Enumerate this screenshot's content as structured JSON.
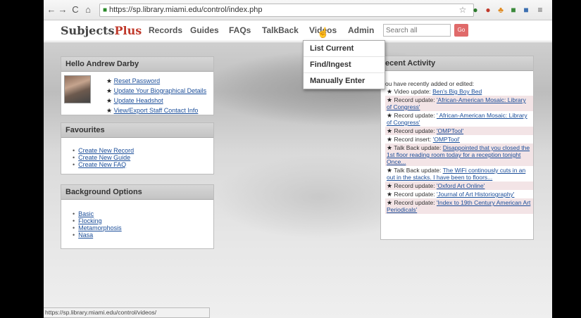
{
  "browser": {
    "url": "https://sp.library.miami.edu/control/index.php",
    "status_url": "https://sp.library.miami.edu/control/videos/"
  },
  "site": {
    "logo_main": "Subjects",
    "logo_accent": "Plus",
    "nav": [
      "Records",
      "Guides",
      "FAQs",
      "TalkBack",
      "Videos",
      "Admin"
    ],
    "search_placeholder": "Search all",
    "search_button": "Go"
  },
  "dropdown": {
    "items": [
      "List Current",
      "Find/Ingest",
      "Manually Enter"
    ]
  },
  "hello": {
    "title": "Hello Andrew Darby",
    "links": [
      "Reset Password",
      "Update Your Biographical Details",
      "Update Headshot",
      "View/Export Staff Contact Info"
    ]
  },
  "favourites": {
    "title": "Favourites",
    "links": [
      "Create New Record",
      "Create New Guide",
      "Create New FAQ"
    ]
  },
  "background": {
    "title": "Background Options",
    "links": [
      "Basic",
      "Flocking",
      "Metamorphosis",
      "Nasa"
    ]
  },
  "recent": {
    "title": "ecent Activity",
    "intro": "ou have recently added or edited:",
    "items": [
      {
        "prefix": "Video update: ",
        "link": "Ben's Big Boy Bed"
      },
      {
        "prefix": "Record update: ",
        "link": "'African-American Mosaic: Library of Congress'"
      },
      {
        "prefix": "Record update: ",
        "link": "' African-American Mosaic: Library of Congress'"
      },
      {
        "prefix": "Record update: ",
        "link": "'OMPTool'"
      },
      {
        "prefix": "Record insert: ",
        "link": "'OMPTool'"
      },
      {
        "prefix": "Talk Back update: ",
        "link": "Disappointed that you closed the 1st floor reading room today for a reception tonight Once..."
      },
      {
        "prefix": "Talk Back update: ",
        "link": "The WiFi continously cuts in an out in the stacks. I have been to floors..."
      },
      {
        "prefix": "Record update: ",
        "link": "'Oxford Art Online'"
      },
      {
        "prefix": "Record update: ",
        "link": "'Journal of Art Historiography'"
      },
      {
        "prefix": "Record update: ",
        "link": "'Index to 19th Century American Art Periodicals'"
      }
    ]
  },
  "colors": {
    "accent": "#c0392b",
    "link": "#1a4d99",
    "highlight_row": "#f3e4e6"
  }
}
